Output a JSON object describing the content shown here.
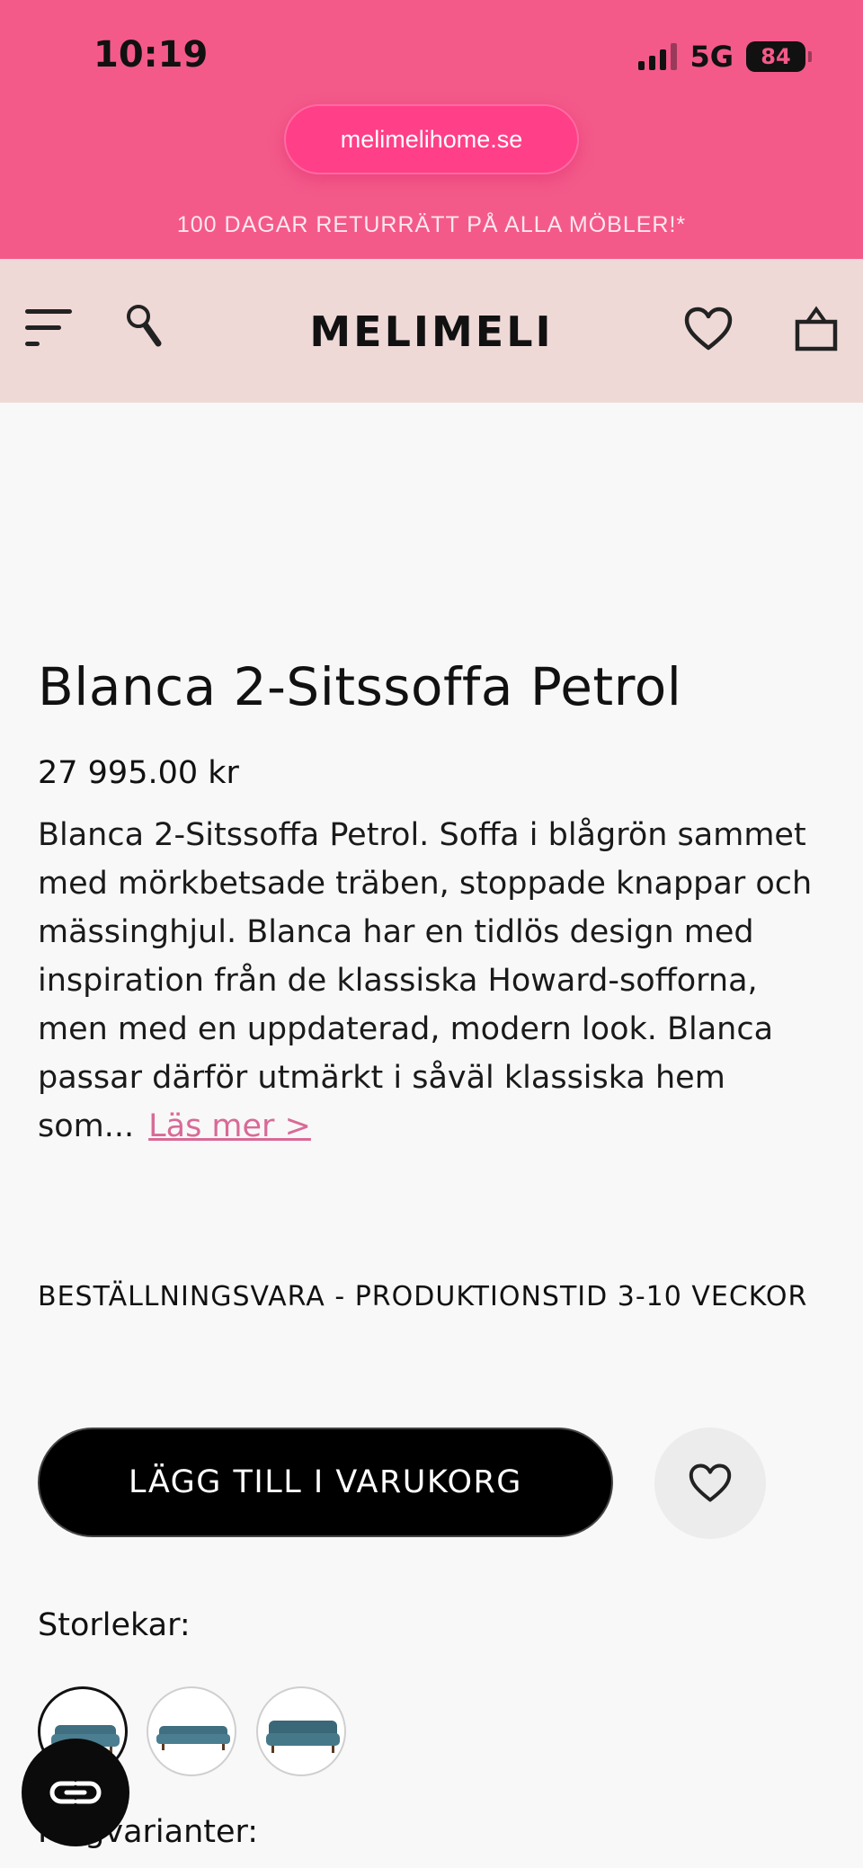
{
  "status_bar": {
    "time": "10:19",
    "network": "5G",
    "battery": "84"
  },
  "browser": {
    "url": "melimelihome.se"
  },
  "promo_banner": {
    "text": "100 DAGAR RETURRÄTT PÅ ALLA MÖBLER!*"
  },
  "header": {
    "logo": "MELIMELI",
    "icons": [
      "menu-icon",
      "search-icon",
      "heart-icon",
      "shopping-bag-icon"
    ]
  },
  "product": {
    "title": "Blanca 2-Sitssoffa Petrol",
    "price": "27 995.00 kr",
    "description": "Blanca 2-Sitssoffa Petrol. Soffa i blågrön sammet med mörkbetsade träben, stoppade knappar och mässinghjul. Blanca har en tidlös design med inspiration från de klassiska Howard-sofforna, men med en uppdaterad, modern look. Blanca passar därför utmärkt i såväl klassiska hem som...",
    "read_more": "Läs mer >",
    "lead_time": "BESTÄLLNINGSVARA - PRODUKTIONSTID 3-10 VECKOR",
    "add_to_cart": "LÄGG TILL I VARUKORG"
  },
  "sizes": {
    "label": "Storlekar:",
    "options_count": 3,
    "selected_index": 0
  },
  "colors": {
    "label": "Färgvarianter:"
  },
  "theme": {
    "pink": "#f35a8a",
    "header_bg": "#efd9d7",
    "accent_link": "#d86a96",
    "sofa_teal": "#3f6f80"
  }
}
